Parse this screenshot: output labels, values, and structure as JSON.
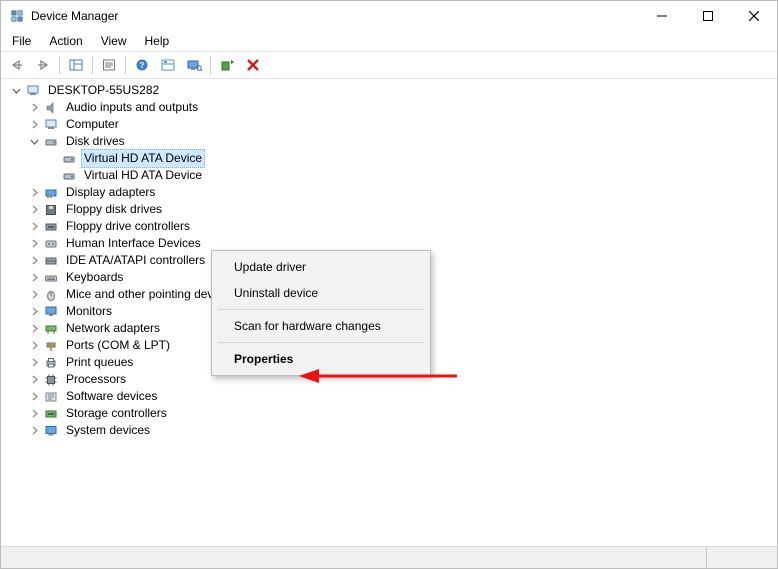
{
  "window": {
    "title": "Device Manager"
  },
  "menubar": {
    "file": "File",
    "action": "Action",
    "view": "View",
    "help": "Help"
  },
  "tree": {
    "root": "DESKTOP-55US282",
    "audio": "Audio inputs and outputs",
    "computer": "Computer",
    "disk": "Disk drives",
    "disk_child_1": "Virtual HD ATA Device",
    "disk_child_2": "Virtual HD ATA Device",
    "display": "Display adapters",
    "floppy_drives": "Floppy disk drives",
    "floppy_ctl": "Floppy drive controllers",
    "hid": "Human Interface Devices",
    "ide": "IDE ATA/ATAPI controllers",
    "keyboards": "Keyboards",
    "mice": "Mice and other pointing devices",
    "monitors": "Monitors",
    "network": "Network adapters",
    "ports": "Ports (COM & LPT)",
    "printq": "Print queues",
    "processors": "Processors",
    "software": "Software devices",
    "storage": "Storage controllers",
    "system": "System devices"
  },
  "context_menu": {
    "update": "Update driver",
    "uninstall": "Uninstall device",
    "scan": "Scan for hardware changes",
    "properties": "Properties"
  }
}
